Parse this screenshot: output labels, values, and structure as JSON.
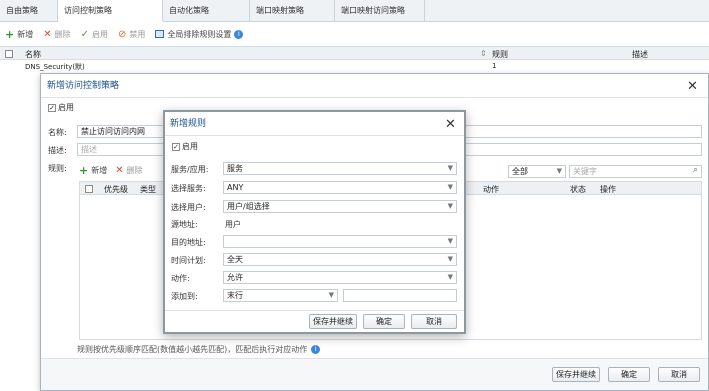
{
  "tabs": [
    "自由策略",
    "访问控制策略",
    "自动化策略",
    "端口映射策略",
    "端口映射访问策略"
  ],
  "toolbar": {
    "add": "新增",
    "delete": "删除",
    "enable": "启用",
    "disable": "禁用",
    "show_match": "全局排除规则设置"
  },
  "bg_table": {
    "headers": [
      "名称",
      "规则",
      "描述"
    ],
    "rows": [
      {
        "name": "DNS_Security(默)",
        "rule": "1"
      }
    ]
  },
  "outer_dialog": {
    "title": "新增访问控制策略",
    "enable_label": "启用",
    "name_label": "名称:",
    "name_value": "禁止访问访问内网",
    "desc_label": "描述:",
    "desc_placeholder": "描述",
    "rules_label": "规则:",
    "rule_toolbar": {
      "add": "新增",
      "delete": "删除"
    },
    "filter_select": "全部",
    "filter_placeholder": "关键字",
    "rule_headers": [
      "优先级",
      "类型",
      "动作",
      "状态",
      "操作"
    ],
    "hint": "规则按优先级顺序匹配(数值越小越先匹配)，匹配后执行对应动作",
    "footer": {
      "save_continue": "保存并继续",
      "ok": "确定",
      "cancel": "取消"
    }
  },
  "inner_dialog": {
    "title": "新增规则",
    "enable_label": "启用",
    "fields": [
      {
        "label": "服务/应用:",
        "value": "服务",
        "type": "select"
      },
      {
        "label": "选择服务:",
        "value": "ANY",
        "type": "select"
      },
      {
        "label": "选择用户:",
        "value": "用户/组选择",
        "type": "select"
      },
      {
        "label": "源地址:",
        "value": "用户",
        "type": "text"
      },
      {
        "label": "目的地址:",
        "value": "",
        "type": "select"
      },
      {
        "label": "时间计划:",
        "value": "全天",
        "type": "select"
      },
      {
        "label": "动作:",
        "value": "允许",
        "type": "select"
      },
      {
        "label": "添加到:",
        "value": "末行",
        "type": "select-with-input"
      }
    ],
    "footer": {
      "save_continue": "保存并继续",
      "ok": "确定",
      "cancel": "取消"
    }
  }
}
